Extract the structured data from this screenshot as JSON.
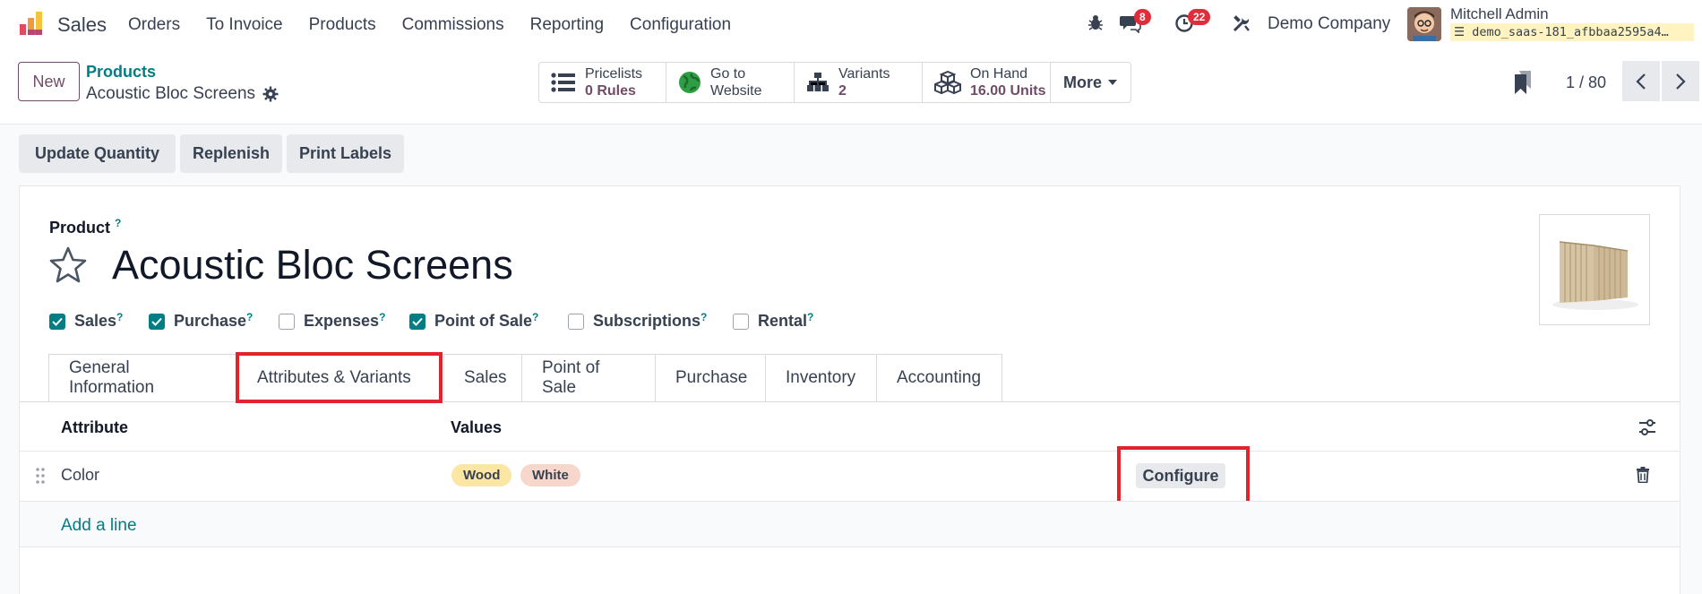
{
  "nav": {
    "app_name": "Sales",
    "menu": [
      "Orders",
      "To Invoice",
      "Products",
      "Commissions",
      "Reporting",
      "Configuration"
    ],
    "messages_count": "8",
    "activities_count": "22",
    "company": "Demo Company",
    "user_name": "Mitchell Admin",
    "database": "demo_saas-181_afbbaa2595a4…"
  },
  "control_panel": {
    "new_label": "New",
    "breadcrumb_parent": "Products",
    "breadcrumb_current": "Acoustic Bloc Screens",
    "stats": {
      "pricelists_label": "Pricelists",
      "pricelists_value": "0 Rules",
      "website_line1": "Go to",
      "website_line2": "Website",
      "variants_label": "Variants",
      "variants_value": "2",
      "onhand_label": "On Hand",
      "onhand_value": "16.00 Units",
      "more_label": "More"
    },
    "pager": "1 / 80"
  },
  "actions": [
    "Update Quantity",
    "Replenish",
    "Print Labels"
  ],
  "form": {
    "product_label": "Product",
    "help_mark": "?",
    "product_name": "Acoustic Bloc Screens",
    "checkboxes": [
      {
        "label": "Sales",
        "checked": true
      },
      {
        "label": "Purchase",
        "checked": true
      },
      {
        "label": "Expenses",
        "checked": false
      },
      {
        "label": "Point of Sale",
        "checked": true
      },
      {
        "label": "Subscriptions",
        "checked": false
      },
      {
        "label": "Rental",
        "checked": false
      }
    ],
    "tabs": [
      "General Information",
      "Attributes & Variants",
      "Sales",
      "Point of Sale",
      "Purchase",
      "Inventory",
      "Accounting"
    ],
    "active_tab": "Attributes & Variants"
  },
  "attributes_table": {
    "headers": {
      "attribute": "Attribute",
      "values": "Values"
    },
    "rows": [
      {
        "attribute": "Color",
        "values": [
          "Wood",
          "White"
        ],
        "action": "Configure"
      }
    ],
    "add_line": "Add a line"
  },
  "colors": {
    "brand": "#714b67",
    "link": "#017e84",
    "highlight": "#e2222d",
    "tag_wood": "#fbe6a3",
    "tag_white": "#f7d6cc"
  }
}
